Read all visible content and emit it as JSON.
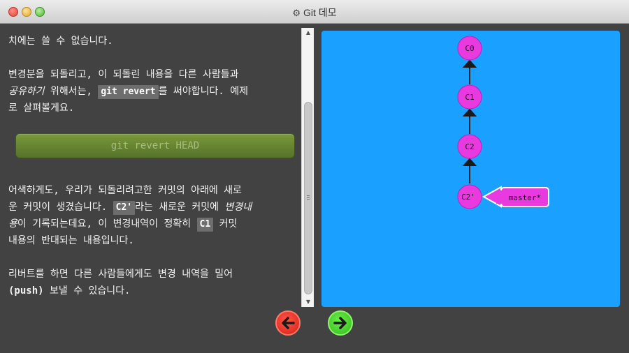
{
  "window": {
    "title": "Git 데모",
    "title_icon": "gear-icon"
  },
  "content": {
    "p0": {
      "text": "치에는 쓸 수 없습니다."
    },
    "p1": {
      "line1": "변경분을 되돌리고, 이 되돌린 내용을 다른 사람들과",
      "em": "공유하기",
      "mid": " 위해서는, ",
      "code": "git revert",
      "tail": "를 써야합니다. 예제",
      "line3": "로 살펴볼게요."
    },
    "command_button": "git revert HEAD",
    "p2": {
      "a": "어색하게도, 우리가 되돌리려고한 커밋의 아래에 새로",
      "b": "운 커밋이 생겼습니다. ",
      "code1": "C2'",
      "c": "라는 새로운 커밋에 ",
      "em1": "변경내",
      "em2": "용",
      "d": "이 기록되는데요, 이 변경내역이 정확히 ",
      "code2": "C1",
      "e": " 커밋",
      "f": "내용의 반대되는 내용입니다."
    },
    "p3": {
      "a": "리버트를 하면 다른 사람들에게도 변경 내역을 밀어",
      "bold": "(push)",
      "b": " 보낼 수 있습니다."
    }
  },
  "visualization": {
    "background": "#1aa0ff",
    "node_color": "#e93adf",
    "commits": [
      "C0",
      "C1",
      "C2",
      "C2'"
    ],
    "branch": "master*"
  },
  "nav": {
    "back_icon": "arrow-left-icon",
    "forward_icon": "arrow-right-icon"
  }
}
